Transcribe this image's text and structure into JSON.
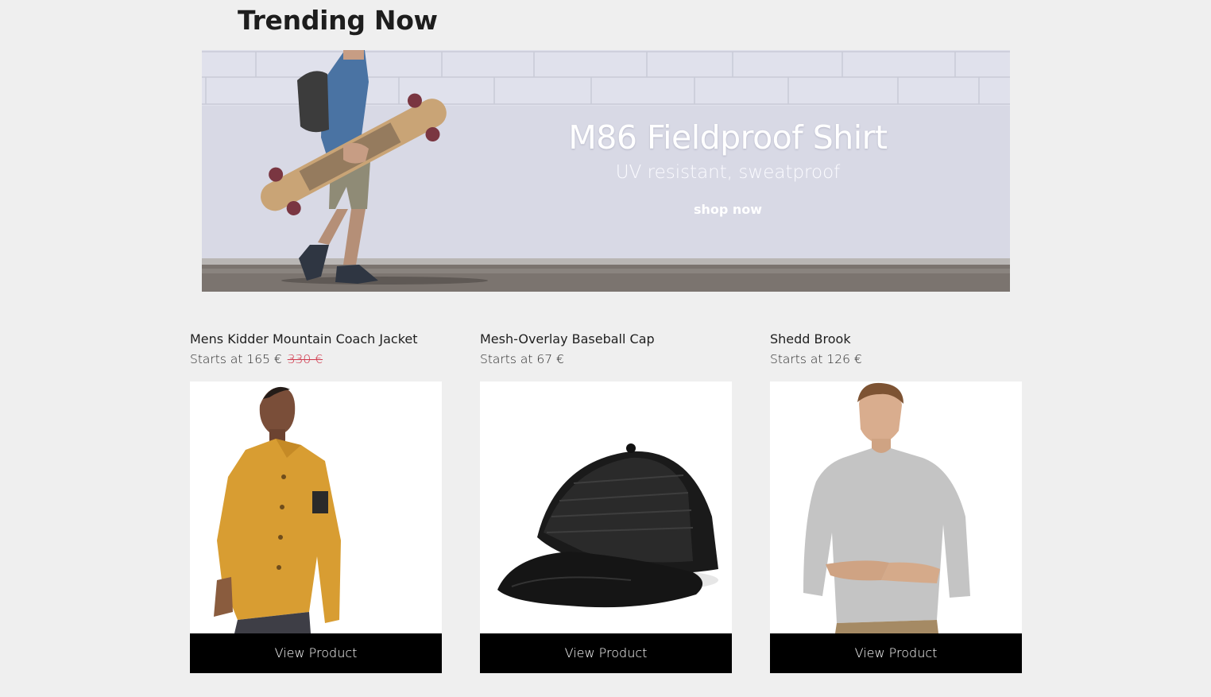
{
  "section": {
    "title": "Trending Now"
  },
  "hero": {
    "title": "M86 Fieldproof Shirt",
    "subtitle": "UV resistant, sweatproof",
    "cta": "shop now",
    "image": "skateboarder-walking-by-wall"
  },
  "products": [
    {
      "name": "Mens Kidder Mountain Coach Jacket",
      "price": "Starts at 165 €",
      "old_price": "330 €",
      "image": "yellow-jacket",
      "button": "View Product"
    },
    {
      "name": "Mesh-Overlay Baseball Cap",
      "price": "Starts at 67 €",
      "image": "black-cap",
      "button": "View Product"
    },
    {
      "name": "Shedd Brook",
      "price": "Starts at 126 €",
      "image": "grey-sweatshirt",
      "button": "View Product"
    }
  ],
  "colors": {
    "background": "#efefef",
    "button": "#000000",
    "sale": "#d0364a"
  }
}
